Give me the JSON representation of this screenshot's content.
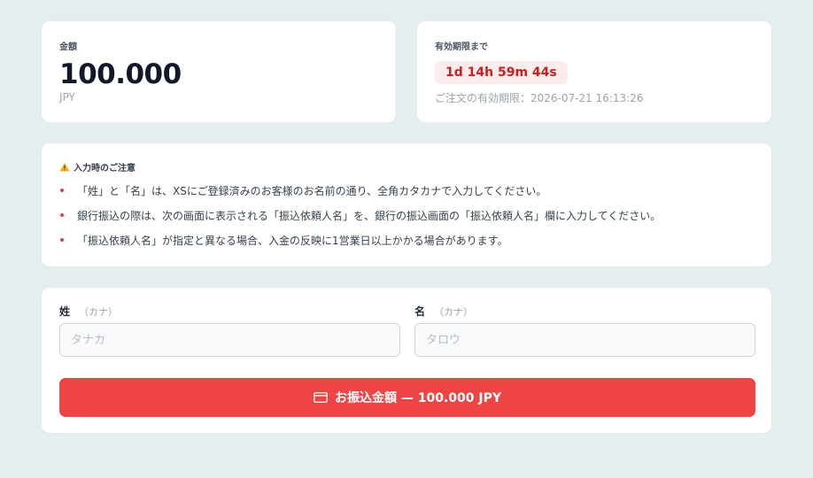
{
  "amount": {
    "label": "金額",
    "value": "100.000",
    "currency": "JPY"
  },
  "expiry": {
    "label": "有効期限まで",
    "countdown": "1d 14h 59m 44s",
    "deadline_text": "ご注文の有効期限：2026-07-21 16:13:26"
  },
  "notice": {
    "icon": "warning-icon",
    "title": "入力時のご注意",
    "items": [
      "「姓」と「名」は、XSにご登録済みのお客様のお名前の通り、全角カタカナで入力してください。",
      "銀行振込の際は、次の画面に表示される「振込依頼人名」を、銀行の振込画面の「振込依頼人名」欄に入力してください。",
      "「振込依頼人名」が指定と異なる場合、入金の反映に1営業日以上かかる場合があります。"
    ],
    "bullet_color": "#e53e3e"
  },
  "form": {
    "last_name": {
      "label": "姓",
      "sub": "（カナ）",
      "placeholder": "タナカ",
      "value": ""
    },
    "first_name": {
      "label": "名",
      "sub": "（カナ）",
      "placeholder": "タロウ",
      "value": ""
    },
    "submit": {
      "icon": "credit-card-icon",
      "label": "お振込金額 — 100.000 JPY"
    }
  },
  "colors": {
    "background": "#e4eeee",
    "accent": "#ef4444",
    "countdown_bg": "#fdecec",
    "countdown_text": "#c81e1e"
  }
}
